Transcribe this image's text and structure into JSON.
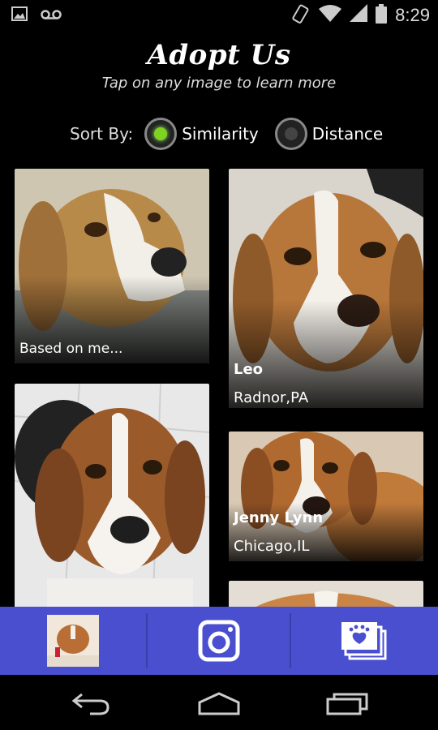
{
  "status_bar": {
    "time": "8:29",
    "left_icons": [
      "image-icon",
      "voicemail-icon"
    ],
    "right_icons": [
      "vibrate-icon",
      "wifi-icon",
      "signal-icon",
      "battery-icon"
    ]
  },
  "header": {
    "title": "Adopt Us",
    "subtitle": "Tap on any image to learn more"
  },
  "sort": {
    "label": "Sort By:",
    "options": [
      {
        "label": "Similarity",
        "selected": true
      },
      {
        "label": "Distance",
        "selected": false
      }
    ],
    "selected_color": "#7ed321"
  },
  "cards": [
    {
      "caption": "Based on me...",
      "name": "",
      "location": ""
    },
    {
      "caption": "",
      "name": "Leo",
      "location": "Radnor,PA"
    },
    {
      "caption": "",
      "name": "",
      "location": ""
    },
    {
      "caption": "",
      "name": "Jenny Lynn",
      "location": "Chicago,IL"
    },
    {
      "caption": "",
      "name": "",
      "location": ""
    }
  ],
  "bottom_bar": {
    "color": "#4a4fd0",
    "items": [
      "profile-thumbnail",
      "camera-icon",
      "gallery-icon"
    ]
  },
  "nav_bar": {
    "items": [
      "back-icon",
      "home-icon",
      "recents-icon"
    ]
  }
}
